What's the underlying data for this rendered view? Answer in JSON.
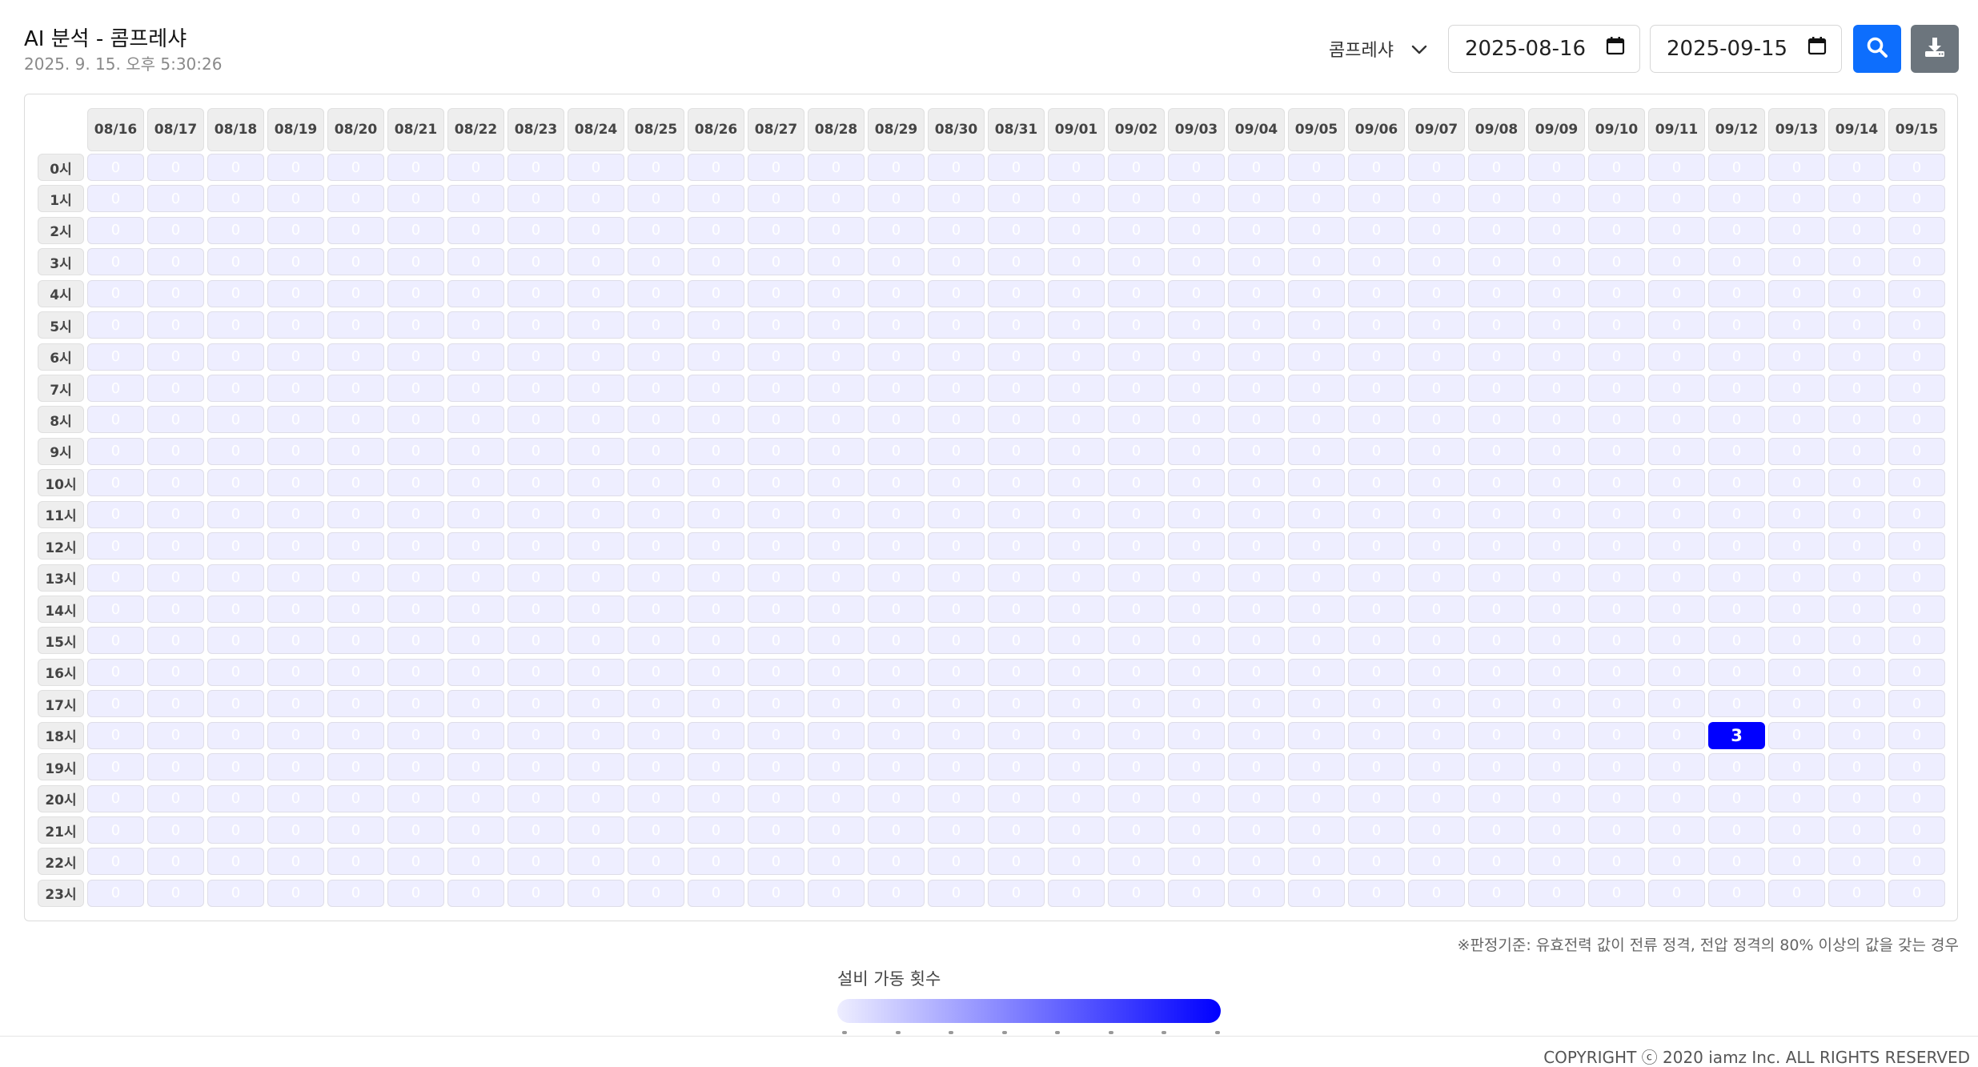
{
  "header": {
    "title": "AI 분석 - 콤프레샤",
    "timestamp": "2025. 9. 15. 오후 5:30:26"
  },
  "controls": {
    "equipment_select": "콤프레샤",
    "start_date": "2025-08-16",
    "end_date": "2025-09-15",
    "search_icon": "search-icon",
    "download_icon": "download-icon"
  },
  "heatmap": {
    "dates": [
      "08/16",
      "08/17",
      "08/18",
      "08/19",
      "08/20",
      "08/21",
      "08/22",
      "08/23",
      "08/24",
      "08/25",
      "08/26",
      "08/27",
      "08/28",
      "08/29",
      "08/30",
      "08/31",
      "09/01",
      "09/02",
      "09/03",
      "09/04",
      "09/05",
      "09/06",
      "09/07",
      "09/08",
      "09/09",
      "09/10",
      "09/11",
      "09/12",
      "09/13",
      "09/14",
      "09/15"
    ],
    "hours": [
      "0시",
      "1시",
      "2시",
      "3시",
      "4시",
      "5시",
      "6시",
      "7시",
      "8시",
      "9시",
      "10시",
      "11시",
      "12시",
      "13시",
      "14시",
      "15시",
      "16시",
      "17시",
      "18시",
      "19시",
      "20시",
      "21시",
      "22시",
      "23시"
    ],
    "nonzero": [
      {
        "date": "09/12",
        "hour": "18시",
        "value": 3
      }
    ],
    "default_value": 0,
    "max_value": 3,
    "low_color": "#eeeeff",
    "high_color": "#0000ff"
  },
  "criteria_note": "※판정기준: 유효전력 값이 전류 정격, 전압 정격의 80% 이상의 값을 갖는 경우",
  "legend": {
    "title": "설비 가동 횟수"
  },
  "footer": {
    "copyright": "COPYRIGHT ⓒ 2020 iamz Inc. ALL RIGHTS RESERVED"
  }
}
